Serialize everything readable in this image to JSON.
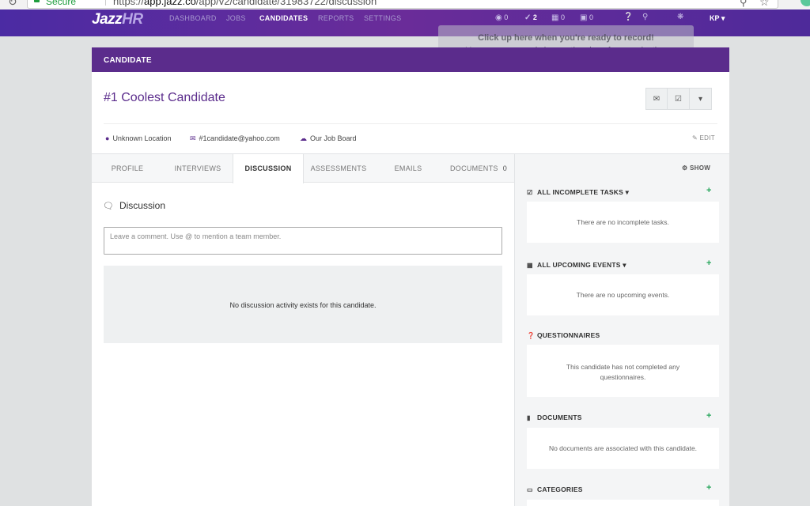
{
  "browser": {
    "secure_label": "Secure",
    "url_scheme": "https://",
    "url_domain": "app.jazz.co",
    "url_path": "/app/v2/candidate/31983722/discussion"
  },
  "nav": {
    "logo_main": "Jazz",
    "logo_hr": "HR",
    "items": [
      "DASHBOARD",
      "JOBS",
      "CANDIDATES",
      "REPORTS",
      "SETTINGS"
    ],
    "stats": {
      "views": "0",
      "checks": "2",
      "calendar": "0",
      "inbox": "0"
    },
    "user": "KP"
  },
  "overlay": {
    "line1": "Click up here when you're ready to record!",
    "line2": "You can move and change the size of your selection"
  },
  "card": {
    "header": "CANDIDATE",
    "name": "#1 Coolest Candidate",
    "location": "Unknown Location",
    "email": "#1candidate@yahoo.com",
    "source": "Our Job Board",
    "edit_label": "EDIT"
  },
  "tabs": {
    "profile": "PROFILE",
    "interviews": "INTERVIEWS",
    "discussion": "DISCUSSION",
    "assessments": "ASSESSMENTS",
    "emails": "EMAILS",
    "documents": "DOCUMENTS",
    "documents_count": "0"
  },
  "discussion": {
    "title": "Discussion",
    "placeholder": "Leave a comment. Use @ to mention a team member.",
    "empty": "No discussion activity exists for this candidate."
  },
  "sidebar": {
    "show_label": "SHOW",
    "tasks_title": "ALL INCOMPLETE TASKS",
    "tasks_empty": "There are no incomplete tasks.",
    "events_title": "ALL UPCOMING EVENTS",
    "events_empty": "There are no upcoming events.",
    "questionnaires_title": "QUESTIONNAIRES",
    "questionnaires_empty": "This candidate has not completed any questionnaires.",
    "documents_title": "DOCUMENTS",
    "documents_empty": "No documents are associated with this candidate.",
    "categories_title": "CATEGORIES"
  },
  "colors": {
    "brand": "#5b2c8c",
    "accent_green": "#26a65b"
  }
}
